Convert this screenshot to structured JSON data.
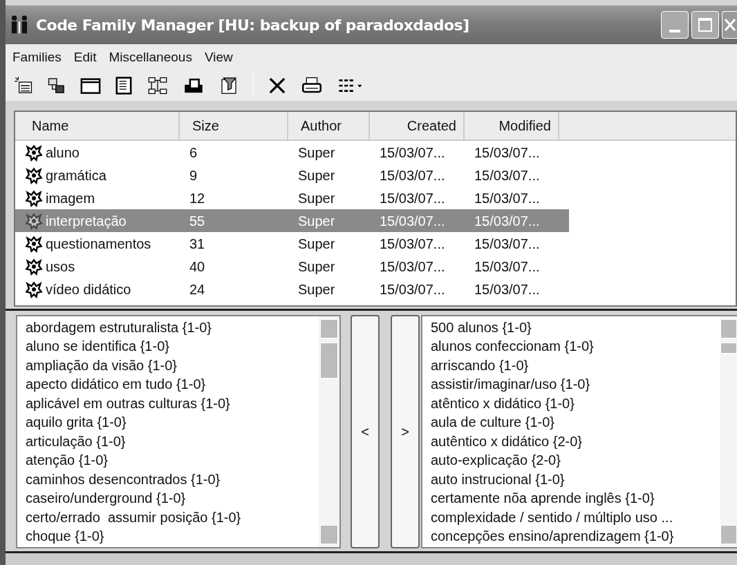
{
  "window": {
    "title": "Code Family Manager [HU: backup of paradoxdados]"
  },
  "menu": [
    "Families",
    "Edit",
    "Miscellaneous",
    "View"
  ],
  "table": {
    "columns": [
      "Name",
      "Size",
      "Author",
      "Created",
      "Modified"
    ],
    "rows": [
      {
        "name": "aluno",
        "size": "6",
        "author": "Super",
        "created": "15/03/07...",
        "modified": "15/03/07...",
        "selected": false
      },
      {
        "name": "gramática",
        "size": "9",
        "author": "Super",
        "created": "15/03/07...",
        "modified": "15/03/07...",
        "selected": false
      },
      {
        "name": "imagem",
        "size": "12",
        "author": "Super",
        "created": "15/03/07...",
        "modified": "15/03/07...",
        "selected": false
      },
      {
        "name": "interpretação",
        "size": "55",
        "author": "Super",
        "created": "15/03/07...",
        "modified": "15/03/07...",
        "selected": true
      },
      {
        "name": "questionamentos",
        "size": "31",
        "author": "Super",
        "created": "15/03/07...",
        "modified": "15/03/07...",
        "selected": false
      },
      {
        "name": "usos",
        "size": "40",
        "author": "Super",
        "created": "15/03/07...",
        "modified": "15/03/07...",
        "selected": false
      },
      {
        "name": "vídeo didático",
        "size": "24",
        "author": "Super",
        "created": "15/03/07...",
        "modified": "15/03/07...",
        "selected": false
      }
    ]
  },
  "member_codes": [
    "abordagem estruturalista {1-0}",
    "aluno se identifica {1-0}",
    "ampliação da visão {1-0}",
    "apecto didático em tudo {1-0}",
    "aplicável em outras culturas {1-0}",
    "aquilo grita {1-0}",
    "articulação {1-0}",
    "atenção {1-0}",
    "caminhos desencontrados {1-0}",
    "caseiro/underground {1-0}",
    "certo/errado  assumir posição {1-0}",
    "choque {1-0}"
  ],
  "move_buttons": [
    "<",
    ">"
  ],
  "other_codes": [
    "500 alunos {1-0}",
    "alunos confeccionam {1-0}",
    "arriscando {1-0}",
    "assistir/imaginar/uso {1-0}",
    "atêntico x didático {1-0}",
    "aula de culture {1-0}",
    "autêntico x didático {2-0}",
    "auto-explicação {2-0}",
    "auto instrucional {1-0}",
    "certamente nõa aprende inglês {1-0}",
    "complexidade / sentido / múltiplo uso ...",
    "concepções ensino/aprendizagem {1-0}"
  ]
}
